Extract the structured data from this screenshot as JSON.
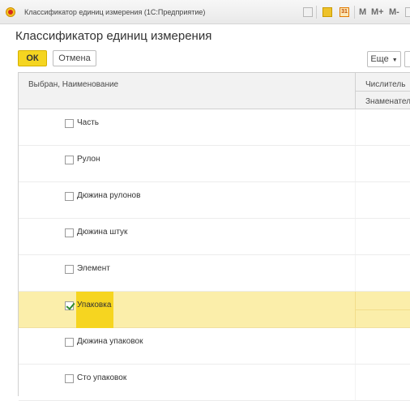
{
  "window": {
    "title": "Классификатор единиц измерения  (1С:Предприятие)",
    "calendar_icon_label": "31",
    "buttons": [
      "M",
      "M+",
      "M-"
    ]
  },
  "page_title": "Классификатор единиц измерения",
  "toolbar": {
    "ok_label": "ОК",
    "cancel_label": "Отмена",
    "more_label": "Еще"
  },
  "columns": {
    "name": "Выбран, Наименование",
    "numerator": "Числитель",
    "denominator": "Знаменатель"
  },
  "rows": [
    {
      "label": "Часть",
      "checked": false
    },
    {
      "label": "Рулон",
      "checked": false
    },
    {
      "label": "Дюжина рулонов",
      "checked": false
    },
    {
      "label": "Дюжина штук",
      "checked": false
    },
    {
      "label": "Элемент",
      "checked": false
    },
    {
      "label": "Упаковка",
      "checked": true
    },
    {
      "label": "Дюжина упаковок",
      "checked": false
    },
    {
      "label": "Сто упаковок",
      "checked": false
    }
  ],
  "colors": {
    "accent": "#f5d520",
    "selected_row": "#fbeeaa",
    "check": "#2e8b2e"
  }
}
